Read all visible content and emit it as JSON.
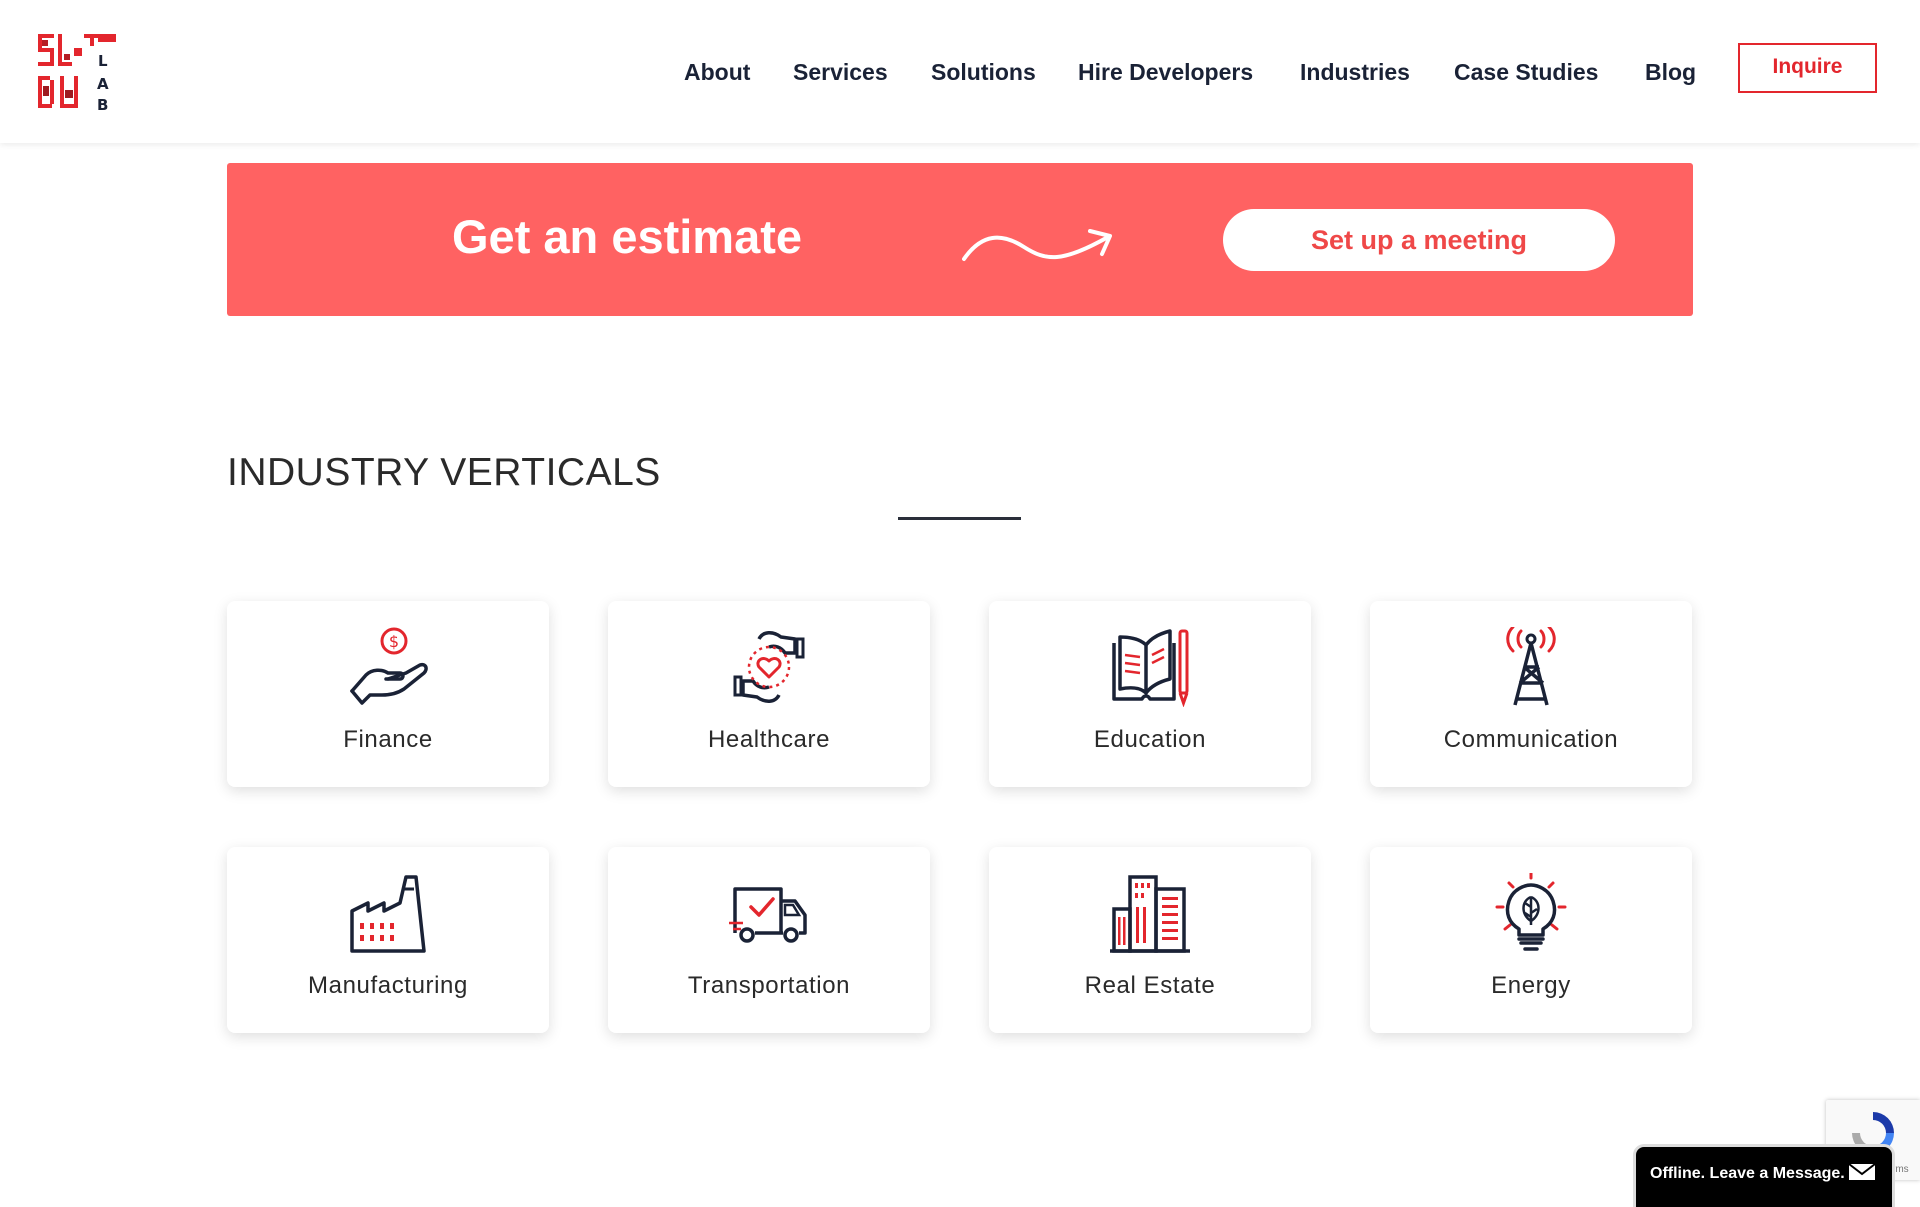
{
  "brand": {
    "logo_letters": [
      "SL",
      "DU",
      "L",
      "A",
      "B"
    ],
    "accent_color": "#e3262d",
    "navy_color": "#1a2236"
  },
  "nav": {
    "items": [
      {
        "label": "About"
      },
      {
        "label": "Services"
      },
      {
        "label": "Solutions"
      },
      {
        "label": "Hire Developers"
      },
      {
        "label": "Industries"
      },
      {
        "label": "Case Studies"
      },
      {
        "label": "Blog"
      }
    ],
    "inquire_label": "Inquire"
  },
  "banner": {
    "title": "Get an estimate",
    "button_label": "Set up a meeting",
    "background": "#ff6262",
    "arrow_icon": "squiggle-arrow-icon"
  },
  "industries": {
    "heading": "INDUSTRY VERTICALS",
    "items": [
      {
        "label": "Finance",
        "icon": "hand-coin-icon"
      },
      {
        "label": "Healthcare",
        "icon": "hands-heart-icon"
      },
      {
        "label": "Education",
        "icon": "book-pencil-icon"
      },
      {
        "label": "Communication",
        "icon": "radio-tower-icon"
      },
      {
        "label": "Manufacturing",
        "icon": "factory-icon"
      },
      {
        "label": "Transportation",
        "icon": "delivery-truck-icon"
      },
      {
        "label": "Real Estate",
        "icon": "buildings-icon"
      },
      {
        "label": "Energy",
        "icon": "eco-bulb-icon"
      }
    ]
  },
  "recaptcha": {
    "terms_fragment": "rms",
    "icon": "recaptcha-icon"
  },
  "chat": {
    "label": "Offline. Leave a Message.",
    "icon": "envelope-icon"
  }
}
